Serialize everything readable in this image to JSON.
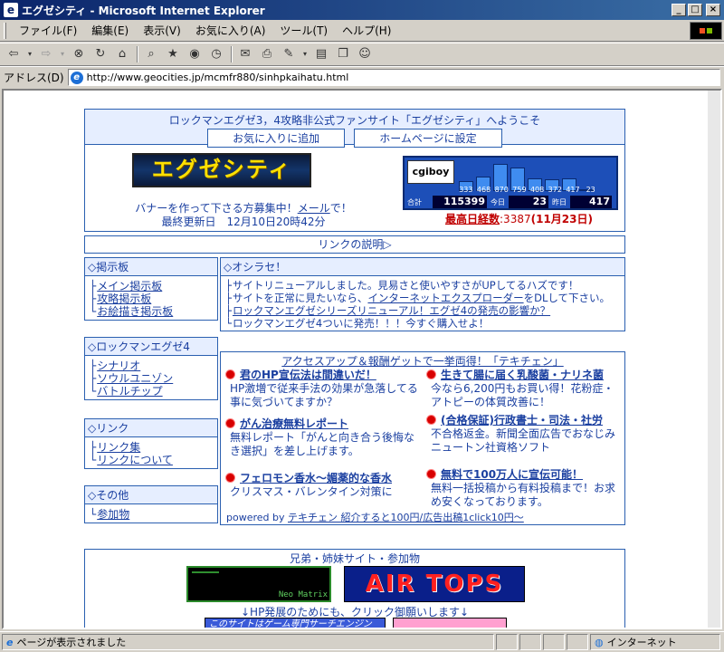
{
  "window": {
    "title": "エグゼシティ - Microsoft Internet Explorer",
    "controls": [
      "_",
      "□",
      "×"
    ]
  },
  "menu": [
    "ファイル(F)",
    "編集(E)",
    "表示(V)",
    "お気に入り(A)",
    "ツール(T)",
    "ヘルプ(H)"
  ],
  "address": {
    "label": "アドレス(D)",
    "url": "http://www.geocities.jp/mcmfr880/sinhpkaihatu.html"
  },
  "header": {
    "welcome": "ロックマンエグゼ3，4攻略非公式ファンサイト「エグゼシティ」へようこそ",
    "favorite_button": "お気に入りに追加",
    "homepage_button": "ホームページに設定"
  },
  "banner": {
    "logo_text": "エグゼシティ",
    "recruit_pre": "バナーを作って下さる方募集中！",
    "recruit_link": "メール",
    "recruit_post": "で！",
    "updated": "最終更新日　12月10日20時42分"
  },
  "counter": {
    "logo": "cgiboy",
    "bars": [
      333,
      468,
      870,
      759,
      408,
      372,
      417,
      23
    ],
    "total_label": "合計",
    "total": "115399",
    "today_label": "今日",
    "today": "23",
    "yesterday_label": "昨日",
    "yesterday": "417",
    "record_link": "最高日経数",
    "record_value": ":3387",
    "record_date": "(11月23日)"
  },
  "link_explain": "リンクの説明▷",
  "sidebar": {
    "bbs": {
      "title": "◇掲示板",
      "items": [
        "メイン掲示板",
        "攻略掲示板",
        "お絵描き掲示板"
      ]
    },
    "exe4": {
      "title": "◇ロックマンエグゼ4",
      "items": [
        "シナリオ",
        "ソウルユニゾン",
        "バトルチップ"
      ]
    },
    "links": {
      "title": "◇リンク",
      "items": [
        "リンク集",
        "リンクについて"
      ]
    },
    "other": {
      "title": "◇その他",
      "items": [
        "参加物"
      ]
    }
  },
  "notice": {
    "title": "◇オシラセ！",
    "line1": "サイトリニューアルしました。見易さと使いやすさがUPしてるハズです！",
    "line2_pre": "サイトを正常に見たいなら、",
    "line2_link": "インターネットエクスプローダー",
    "line2_post": "をDLして下さい。",
    "line3": "ロックマンエグゼシリーズリニューアル！エグゼ4の発売の影響か？",
    "line4": "ロックマンエグゼ4ついに発売！！！今すぐ購入せよ！"
  },
  "ads": {
    "title": "アクセスアップ＆報酬ゲットで一挙両得！「テキチェン」",
    "items": [
      {
        "title": "君のHP宣伝法は間違いだ！",
        "desc": "HP激増で従来手法の効果が急落してる事に気づいてますか？"
      },
      {
        "title": "生きて腸に届く乳酸菌・ナリネ菌",
        "desc": "今なら6,200円もお買い得！花粉症・アトピーの体質改善に！"
      },
      {
        "title": "がん治療無料レポート",
        "desc": "無料レポート「がんと向き合う後悔なき選択」を差し上げます。"
      },
      {
        "title": "(合格保証)行政書士・司法・社労",
        "desc": "不合格返金。新聞全面広告でおなじみニュートン社資格ソフト"
      },
      {
        "title": "フェロモン香水～媚薬的な香水",
        "desc": "クリスマス・バレンタイン対策に"
      },
      {
        "title": "無料で100万人に宣伝可能！",
        "desc": "無料一括投稿から有料投稿まで！お求め安くなっております。"
      }
    ],
    "powered_pre": "powered by ",
    "powered_link": "テキチェン 紹介すると100円/広告出稿1click10円～"
  },
  "sister": {
    "title": "兄弟・姉妹サイト・参加物",
    "neo_label": "Neo Matrix",
    "airtops": "AIR TOPS",
    "click_msg": "↓HP発展のためにも、クリック御願いします↓",
    "banner3": "このサイトはゲーム専門サーチエンジン"
  },
  "status": {
    "text": "ページが表示されました",
    "zone": "インターネット"
  },
  "colors": {
    "border": "#2a5fb0",
    "link": "#1a3fa0",
    "record": "#c00000",
    "banner_text": "#ffe100",
    "counter_bg": "#1d4fb8"
  }
}
